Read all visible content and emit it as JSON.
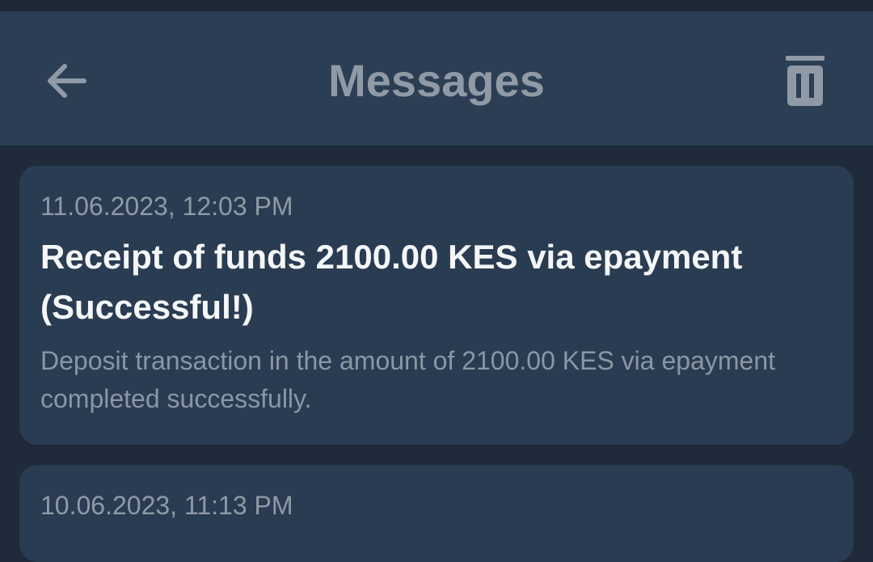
{
  "header": {
    "title": "Messages",
    "back_icon": "arrow-left-icon",
    "delete_icon": "trash-icon"
  },
  "messages": [
    {
      "date": "11.06.2023, 12:03 PM",
      "title": "Receipt of funds 2100.00 KES via epayment (Successful!)",
      "body": "Deposit transaction in the amount of 2100.00 KES via epayment completed successfully."
    },
    {
      "date": "10.06.2023, 11:13 PM"
    }
  ],
  "colors": {
    "background": "#1f2b3a",
    "app_bar": "#2b3e54",
    "card": "#2a3c52",
    "muted_text": "#8f9aa6",
    "title_text": "#f4f6f8"
  }
}
